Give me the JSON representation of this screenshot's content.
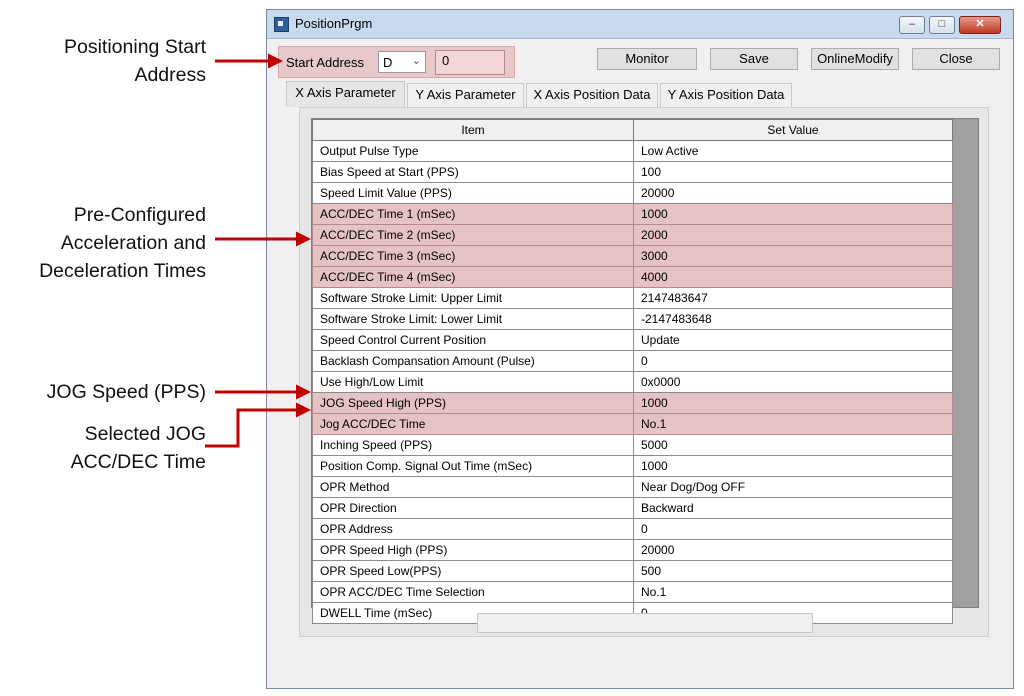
{
  "annotations": {
    "start_address": [
      "Positioning Start",
      "Address"
    ],
    "acc_dec_times": [
      "Pre-Configured",
      "Acceleration and",
      "Deceleration Times"
    ],
    "jog_speed": [
      "JOG Speed (PPS)"
    ],
    "jog_acc_dec": [
      "Selected JOG",
      "ACC/DEC Time"
    ]
  },
  "colors": {
    "arrow": "#c00000",
    "highlight": "#e5c2c4"
  },
  "window": {
    "title": "PositionPrgm",
    "controls": {
      "minimize": "–",
      "maximize": "□",
      "close": "✕"
    }
  },
  "toolbar": {
    "start_address_label": "Start Address",
    "device_value": "D",
    "address_value": "0",
    "buttons": [
      "Monitor",
      "Save",
      "OnlineModify",
      "Close"
    ]
  },
  "tabs": [
    "X Axis Parameter",
    "Y Axis Parameter",
    "X Axis Position Data",
    "Y Axis Position Data"
  ],
  "active_tab": 0,
  "table": {
    "headers": [
      "Item",
      "Set Value"
    ],
    "rows": [
      {
        "item": "Output Pulse Type",
        "value": "Low Active"
      },
      {
        "item": "Bias Speed at Start (PPS)",
        "value": "100"
      },
      {
        "item": "Speed Limit Value (PPS)",
        "value": "20000"
      },
      {
        "item": "ACC/DEC Time 1 (mSec)",
        "value": "1000",
        "highlighted": true
      },
      {
        "item": "ACC/DEC Time 2 (mSec)",
        "value": "2000",
        "highlighted": true
      },
      {
        "item": "ACC/DEC Time 3 (mSec)",
        "value": "3000",
        "highlighted": true
      },
      {
        "item": "ACC/DEC Time 4 (mSec)",
        "value": "4000",
        "highlighted": true
      },
      {
        "item": "Software Stroke Limit: Upper Limit",
        "value": "2147483647"
      },
      {
        "item": "Software Stroke Limit: Lower Limit",
        "value": "-2147483648"
      },
      {
        "item": "Speed Control Current Position",
        "value": "Update"
      },
      {
        "item": "Backlash Compansation Amount (Pulse)",
        "value": "0"
      },
      {
        "item": "Use High/Low Limit",
        "value": "0x0000"
      },
      {
        "item": "JOG Speed High (PPS)",
        "value": "1000",
        "highlighted": true
      },
      {
        "item": "Jog ACC/DEC Time",
        "value": "No.1",
        "highlighted": true
      },
      {
        "item": "Inching Speed (PPS)",
        "value": "5000"
      },
      {
        "item": "Position Comp. Signal Out Time (mSec)",
        "value": "1000"
      },
      {
        "item": "OPR Method",
        "value": "Near Dog/Dog OFF"
      },
      {
        "item": "OPR Direction",
        "value": "Backward"
      },
      {
        "item": "OPR Address",
        "value": "0"
      },
      {
        "item": "OPR Speed High (PPS)",
        "value": "20000"
      },
      {
        "item": "OPR Speed Low(PPS)",
        "value": "500"
      },
      {
        "item": "OPR ACC/DEC Time Selection",
        "value": "No.1"
      },
      {
        "item": "DWELL Time (mSec)",
        "value": "0"
      }
    ]
  }
}
